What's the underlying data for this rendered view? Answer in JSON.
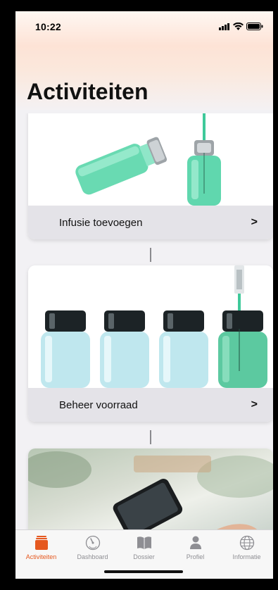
{
  "status": {
    "time": "10:22"
  },
  "page": {
    "title": "Activiteiten"
  },
  "cards": [
    {
      "label": "Infusie toevoegen"
    },
    {
      "label": "Beheer voorraad"
    },
    {
      "label": ""
    }
  ],
  "tabs": [
    {
      "label": "Activiteiten",
      "icon": "box-icon",
      "active": true
    },
    {
      "label": "Dashboard",
      "icon": "gauge-icon",
      "active": false
    },
    {
      "label": "Dossier",
      "icon": "book-icon",
      "active": false
    },
    {
      "label": "Profiel",
      "icon": "person-icon",
      "active": false
    },
    {
      "label": "Informatie",
      "icon": "globe-icon",
      "active": false
    }
  ],
  "colors": {
    "accent": "#e5581f",
    "inactive": "#8e8e93",
    "liquid": "#3fc99a"
  }
}
